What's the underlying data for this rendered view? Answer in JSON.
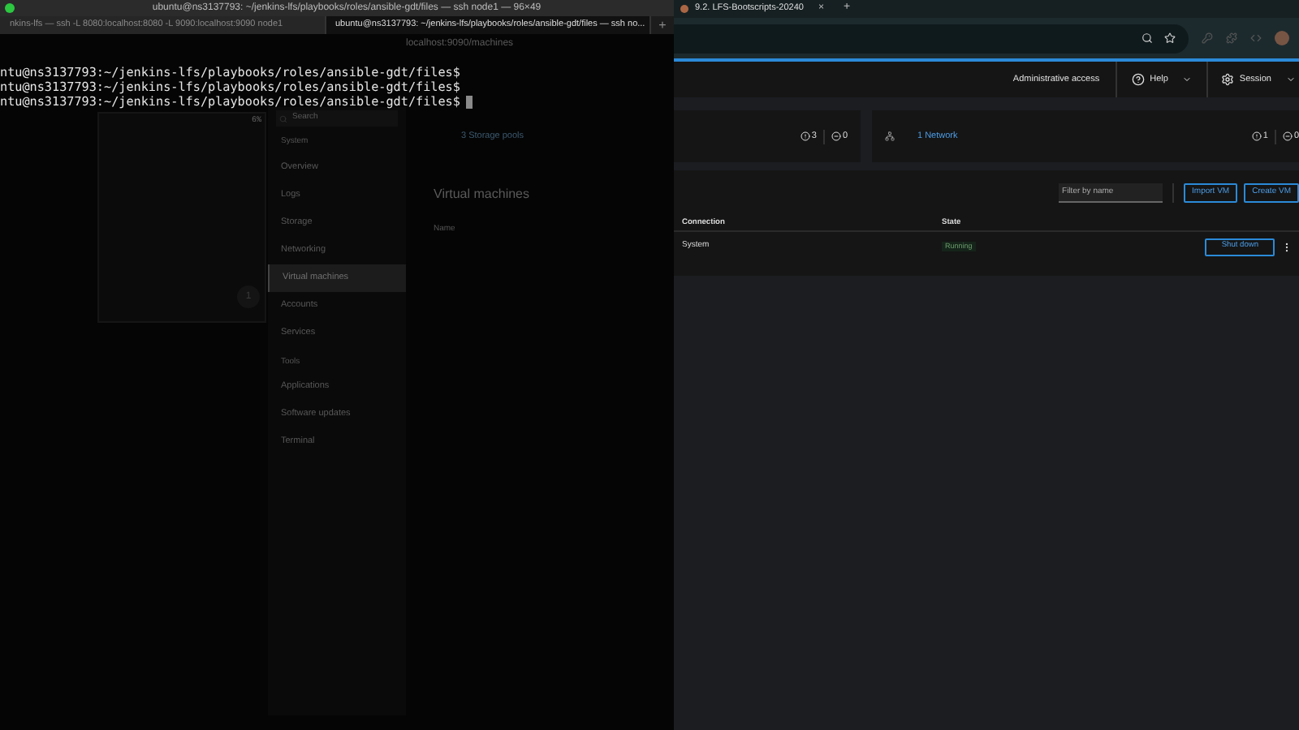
{
  "terminal": {
    "title": "ubuntu@ns3137793: ~/jenkins-lfs/playbooks/roles/ansible-gdt/files — ssh node1 — 96×49",
    "tabs": [
      {
        "label": "nkins-lfs — ssh -L 8080:localhost:8080 -L 9090:localhost:9090 node1",
        "selected": false
      },
      {
        "label": "ubuntu@ns3137793: ~/jenkins-lfs/playbooks/roles/ansible-gdt/files — ssh no...",
        "selected": true
      }
    ],
    "new_tab": "+",
    "lines": [
      "ntu@ns3137793:~/jenkins-lfs/playbooks/roles/ansible-gdt/files$",
      "ntu@ns3137793:~/jenkins-lfs/playbooks/roles/ansible-gdt/files$",
      "ntu@ns3137793:~/jenkins-lfs/playbooks/roles/ansible-gdt/files$"
    ]
  },
  "background_window": {
    "address": "localhost:9090/machines",
    "progress": "6%",
    "search_placeholder": "Search",
    "counter": "1",
    "sidebar": [
      {
        "label": "System",
        "kind": "heading"
      },
      {
        "label": "Overview",
        "kind": "item",
        "selected": false
      },
      {
        "label": "Logs",
        "kind": "item",
        "selected": false
      },
      {
        "label": "Storage",
        "kind": "item",
        "selected": false
      },
      {
        "label": "Networking",
        "kind": "item",
        "selected": false
      },
      {
        "label": "Virtual machines",
        "kind": "item",
        "selected": true
      },
      {
        "label": "Accounts",
        "kind": "item",
        "selected": false
      },
      {
        "label": "Services",
        "kind": "item",
        "selected": false
      },
      {
        "label": "Tools",
        "kind": "heading"
      },
      {
        "label": "Applications",
        "kind": "item",
        "selected": false
      },
      {
        "label": "Software updates",
        "kind": "item",
        "selected": false
      },
      {
        "label": "Terminal",
        "kind": "item",
        "selected": false
      }
    ],
    "storage_link": "3 Storage pools",
    "heading": "Virtual machines",
    "column": "Name"
  },
  "browser": {
    "tab": {
      "title": "9.2. LFS-Bootscripts-20240",
      "close": "×"
    },
    "new_tab": "+",
    "header": {
      "admin": "Administrative access",
      "help": "Help",
      "session": "Session"
    },
    "storage_card": {
      "errors": "3",
      "warnings": "0"
    },
    "network_card": {
      "link": "1 Network",
      "errors": "1",
      "warnings": "0"
    },
    "filter_placeholder": "Filter by name",
    "buttons": [
      "Import VM",
      "Create VM"
    ],
    "columns": [
      "Connection",
      "State"
    ],
    "rows": [
      {
        "connection": "System",
        "state": "Running",
        "action": "Shut down"
      }
    ]
  }
}
